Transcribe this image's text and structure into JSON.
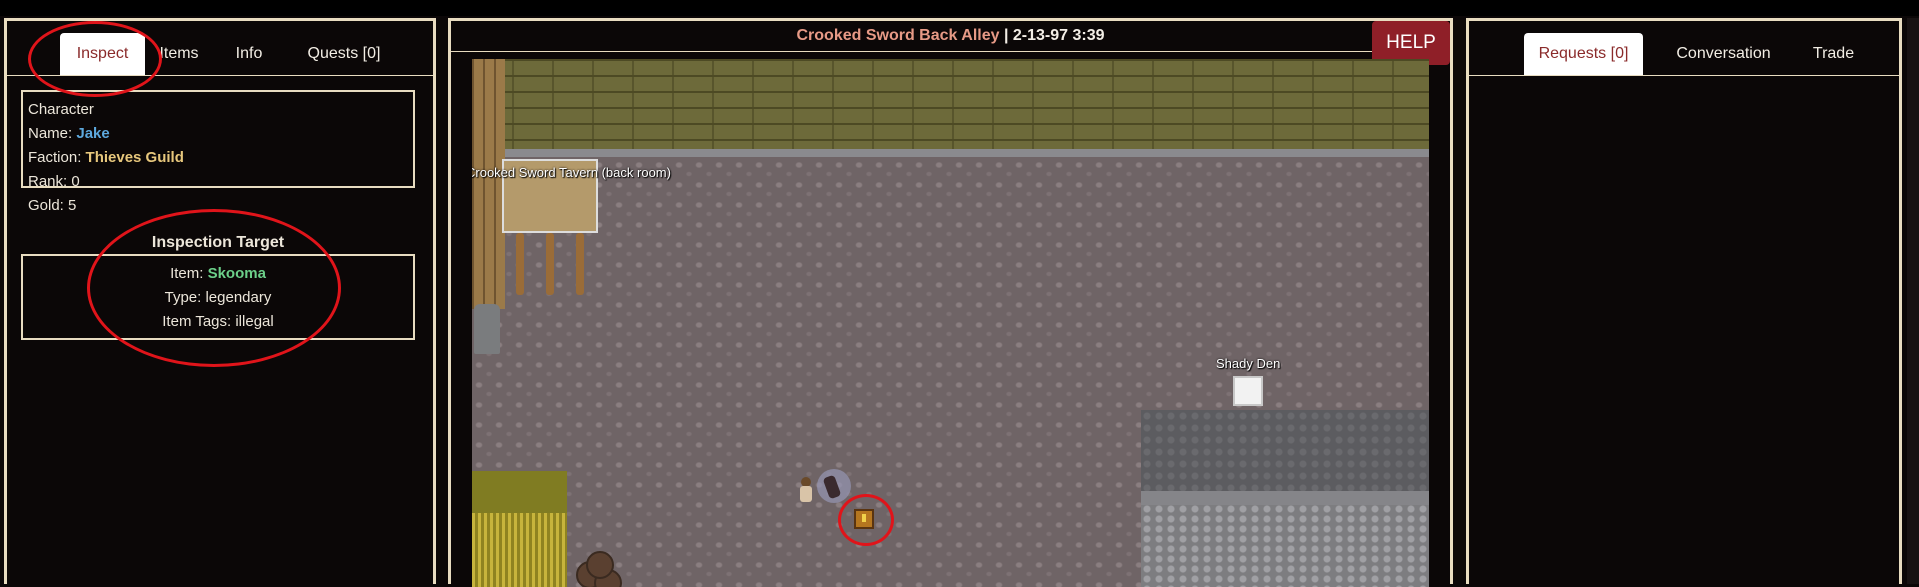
{
  "left_panel": {
    "tabs": [
      {
        "label": "Inspect",
        "active": true
      },
      {
        "label": "Items",
        "active": false
      },
      {
        "label": "Info",
        "active": false
      },
      {
        "label": "Quests [0]",
        "active": false
      }
    ],
    "character": {
      "heading": "Character",
      "name_label": "Name: ",
      "name": "Jake",
      "faction_label": "Faction: ",
      "faction": "Thieves Guild",
      "rank": "Rank: 0",
      "gold": "Gold: 5"
    },
    "inspection": {
      "title": "Inspection Target",
      "item_label": "Item: ",
      "item": "Skooma",
      "type": "Type: legendary",
      "tags": "Item Tags: illegal"
    }
  },
  "map": {
    "location": "Crooked Sword Back Alley",
    "separator": " | ",
    "datetime": "2-13-97 3:39",
    "help_label": "HELP",
    "labels": {
      "tavern": "Crooked Sword Tavern (back room)",
      "den": "Shady Den"
    }
  },
  "right_panel": {
    "tabs": [
      {
        "label": "Requests [0]",
        "active": true
      },
      {
        "label": "Conversation",
        "active": false
      },
      {
        "label": "Trade",
        "active": false
      }
    ]
  },
  "colors": {
    "name": "#5da8dd",
    "faction": "#e7c77c",
    "item": "#6ccf89",
    "location": "#e79a86",
    "help": "#8f1f28",
    "annotation": "#e0141a"
  }
}
